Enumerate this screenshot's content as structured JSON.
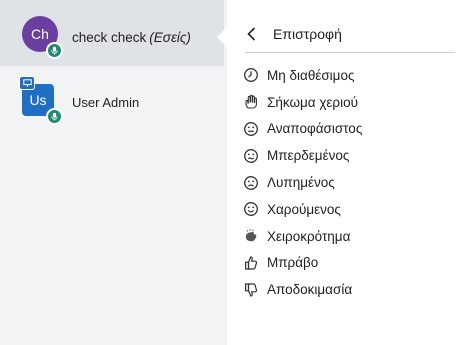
{
  "users": [
    {
      "initials": "Ch",
      "name": "check check",
      "you_label": "(Εσείς)"
    },
    {
      "initials": "Us",
      "name": "User Admin"
    }
  ],
  "menu": {
    "back_label": "Επιστροφή",
    "items": [
      {
        "icon": "clock-icon",
        "label": "Μη διαθέσιμος"
      },
      {
        "icon": "raised-hand-icon",
        "label": "Σήκωμα χεριού"
      },
      {
        "icon": "neutral-face-icon",
        "label": "Αναποφάσιστος"
      },
      {
        "icon": "confused-face-icon",
        "label": "Μπερδεμένος"
      },
      {
        "icon": "sad-face-icon",
        "label": "Λυπημένος"
      },
      {
        "icon": "happy-face-icon",
        "label": "Χαρούμενος"
      },
      {
        "icon": "clapping-hands-icon",
        "label": "Χειροκρότημα"
      },
      {
        "icon": "thumbs-up-icon",
        "label": "Μπράβο"
      },
      {
        "icon": "thumbs-down-icon",
        "label": "Αποδοκιμασία"
      }
    ]
  },
  "colors": {
    "self_avatar": "#6b3fa0",
    "admin_avatar": "#1f6fc5",
    "mic_badge": "#1e8a6e",
    "selected_row": "#dfe3e8"
  }
}
